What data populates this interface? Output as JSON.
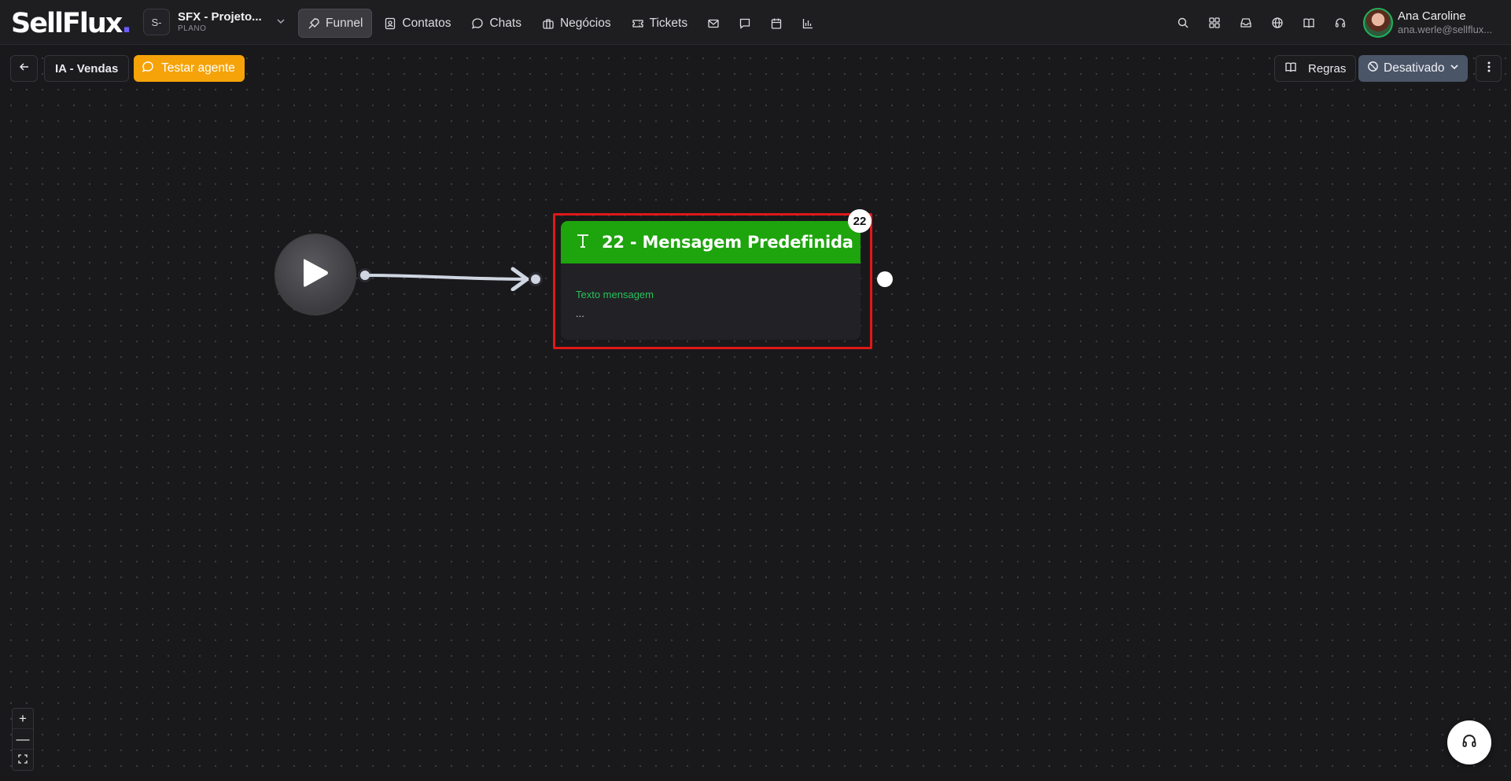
{
  "brand": {
    "name": "SellFlux",
    "suffix": "."
  },
  "project": {
    "badge": "S-",
    "name": "SFX - Projeto...",
    "plan": "PLANO"
  },
  "nav": {
    "items": [
      {
        "label": "Funnel",
        "icon": "rocket-icon",
        "active": true
      },
      {
        "label": "Contatos",
        "icon": "contacts-icon"
      },
      {
        "label": "Chats",
        "icon": "chat-icon"
      },
      {
        "label": "Negócios",
        "icon": "briefcase-icon"
      },
      {
        "label": "Tickets",
        "icon": "ticket-icon"
      }
    ],
    "icon_items": [
      "mail-icon",
      "message-square-icon",
      "calendar-icon",
      "bar-chart-icon"
    ]
  },
  "header_icons": [
    "search-icon",
    "apps-grid-icon",
    "inbox-icon",
    "globe-icon",
    "book-icon",
    "headset-icon"
  ],
  "user": {
    "name": "Ana Caroline",
    "email": "ana.werle@sellflux..."
  },
  "toolbar": {
    "breadcrumb": "IA - Vendas",
    "test_label": "Testar agente",
    "rules_label": "Regras",
    "status_label": "Desativado"
  },
  "flow": {
    "node": {
      "badge": "22",
      "title": "22 - Mensagem Predefinida",
      "field_label": "Texto mensagem",
      "field_value": "...",
      "header_color": "#1ea40d"
    }
  },
  "zoom_controls": {
    "in": "+",
    "out": "—",
    "fit": "⛶"
  },
  "colors": {
    "accent_orange": "#f5a309",
    "status_gray": "#4b5568",
    "selection_red": "#e01818",
    "label_green": "#27c25a"
  }
}
